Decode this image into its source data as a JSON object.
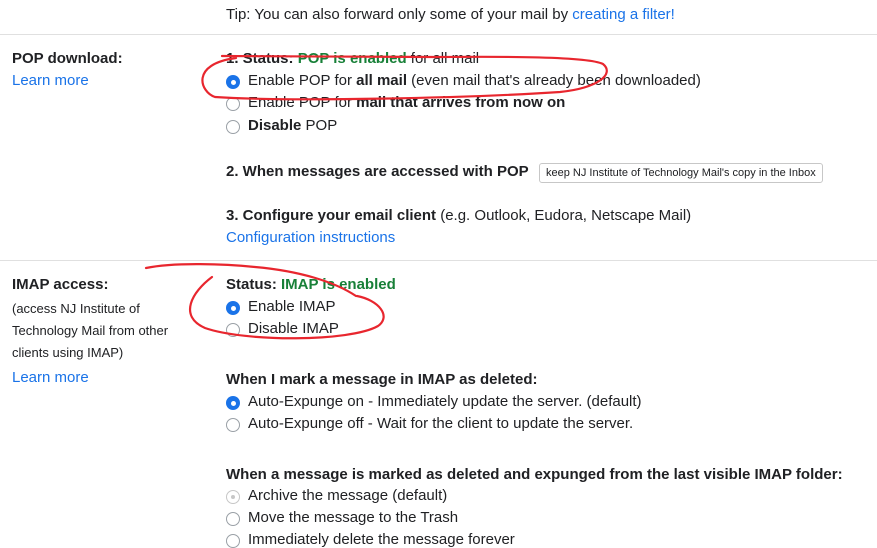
{
  "tip": {
    "text": "Tip: You can also forward only some of your mail by ",
    "link": "creating a filter!"
  },
  "pop": {
    "title": "POP download:",
    "learn_more": "Learn more",
    "status_prefix": "1. Status: ",
    "status_value": "POP is enabled",
    "status_suffix": " for all mail",
    "options": [
      {
        "pre": "Enable POP for ",
        "bold": "all mail",
        "post": " (even mail that's already been downloaded)",
        "selected": true
      },
      {
        "pre": "Enable POP for ",
        "bold": "mail that arrives from now on",
        "post": "",
        "selected": false
      },
      {
        "pre": "",
        "bold": "Disable",
        "post": " POP",
        "selected": false
      }
    ],
    "access_label": "2. When messages are accessed with POP",
    "access_select": "keep NJ Institute of Technology Mail's copy in the Inbox",
    "configure_label": "3. Configure your email client",
    "configure_hint": " (e.g. Outlook, Eudora, Netscape Mail)",
    "configure_link": "Configuration instructions"
  },
  "imap": {
    "title": "IMAP access:",
    "desc_lines": [
      "(access NJ Institute of",
      "Technology Mail from other",
      "clients using IMAP)"
    ],
    "learn_more": "Learn more",
    "status_prefix": "Status: ",
    "status_value": "IMAP is enabled",
    "options": [
      {
        "label": "Enable IMAP",
        "selected": true
      },
      {
        "label": "Disable IMAP",
        "selected": false
      }
    ],
    "deleted_heading": "When I mark a message in IMAP as deleted:",
    "deleted_options": [
      {
        "label": "Auto-Expunge on - Immediately update the server. (default)",
        "selected": true
      },
      {
        "label": "Auto-Expunge off - Wait for the client to update the server.",
        "selected": false
      }
    ],
    "expunged_heading": "When a message is marked as deleted and expunged from the last visible IMAP folder:",
    "expunged_options": [
      {
        "label": "Archive the message (default)",
        "state": "disabled-selected"
      },
      {
        "label": "Move the message to the Trash",
        "state": "unselected"
      },
      {
        "label": "Immediately delete the message forever",
        "state": "unselected"
      }
    ]
  },
  "annotation_color": "#e8262e"
}
